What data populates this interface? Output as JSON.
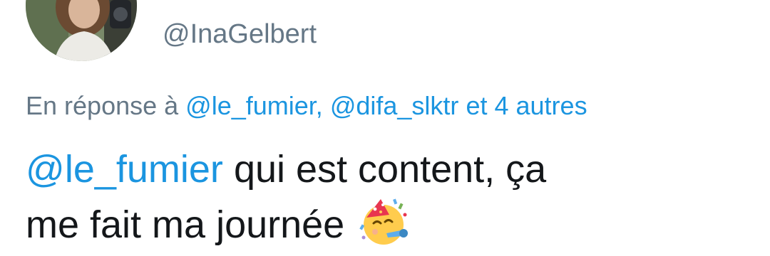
{
  "author": {
    "handle": "@InaGelbert",
    "avatar_icon": "profile-photo"
  },
  "reply": {
    "prefix": "En réponse à",
    "mention_1": "@le_fumier,",
    "mention_2": "@difa_slktr",
    "connector": "et",
    "others": "4 autres"
  },
  "tweet": {
    "mention": "@le_fumier",
    "line1_rest": "qui est content, ça",
    "line2": "me fait ma journée",
    "emoji_icon": "partying-face-emoji"
  },
  "colors": {
    "link": "#1b95e0",
    "secondary_text": "#657786",
    "primary_text": "#14171a"
  }
}
